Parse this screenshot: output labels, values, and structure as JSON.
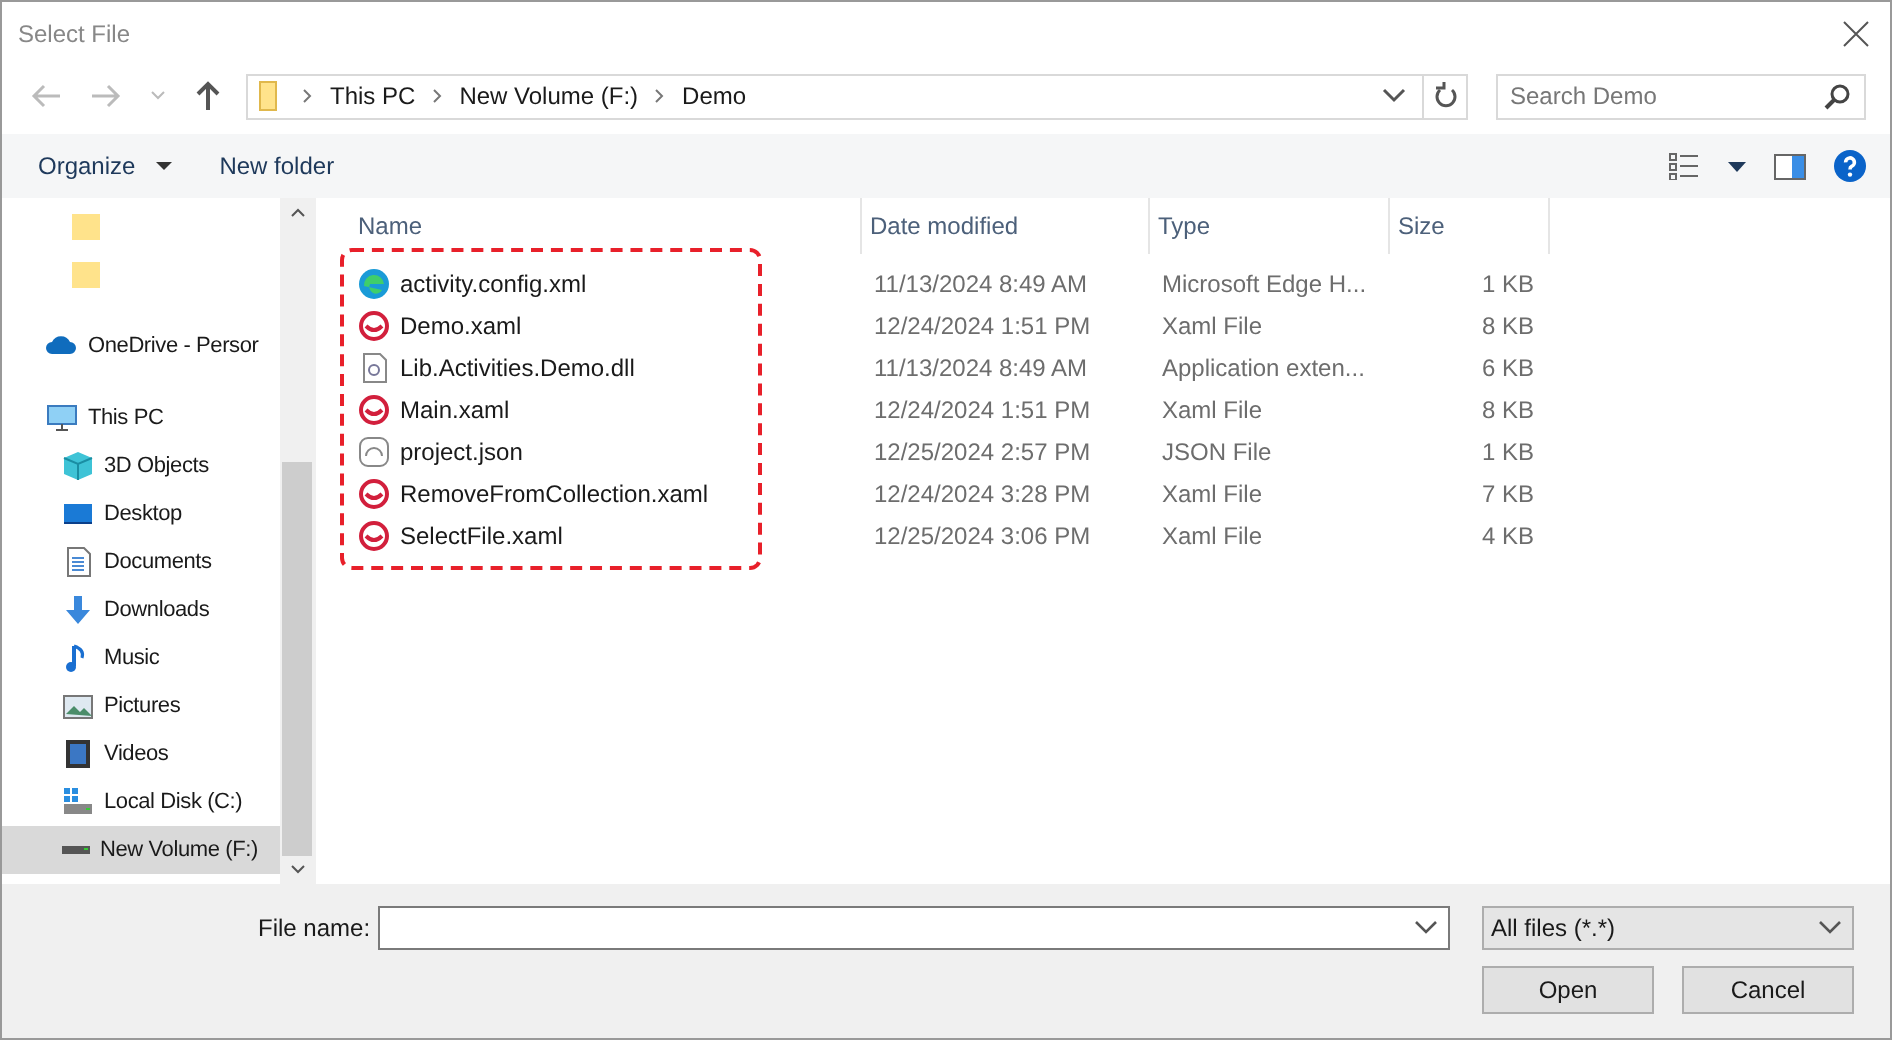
{
  "window": {
    "title": "Select File"
  },
  "address_bar": {
    "path": [
      "This PC",
      "New Volume (F:)",
      "Demo"
    ]
  },
  "search": {
    "placeholder": "Search Demo"
  },
  "toolbar": {
    "organize": "Organize",
    "new_folder": "New folder"
  },
  "sidebar": {
    "items": [
      {
        "kind": "folder",
        "selected": false
      },
      {
        "kind": "folder",
        "selected": false
      },
      {
        "kind": "cloud",
        "label": "OneDrive - Persor",
        "selected": false
      },
      {
        "kind": "pc",
        "label": "This PC",
        "selected": false,
        "children": [
          {
            "kind": "cube",
            "label": "3D Objects",
            "selected": false
          },
          {
            "kind": "desktop",
            "label": "Desktop",
            "selected": false
          },
          {
            "kind": "document",
            "label": "Documents",
            "selected": false
          },
          {
            "kind": "download",
            "label": "Downloads",
            "selected": false
          },
          {
            "kind": "music",
            "label": "Music",
            "selected": false
          },
          {
            "kind": "picture",
            "label": "Pictures",
            "selected": false
          },
          {
            "kind": "video",
            "label": "Videos",
            "selected": false
          },
          {
            "kind": "windisk",
            "label": "Local Disk (C:)",
            "selected": false
          },
          {
            "kind": "disk",
            "label": "New Volume (F:)",
            "selected": true
          }
        ]
      }
    ]
  },
  "file_list": {
    "columns": [
      "Name",
      "Date modified",
      "Type",
      "Size"
    ],
    "names_outlined": true,
    "rows": [
      {
        "kind": "edge",
        "name": "activity.config.xml",
        "date": "11/13/2024 8:49 AM",
        "type": "Microsoft Edge H...",
        "size": "1 KB"
      },
      {
        "kind": "xaml",
        "name": "Demo.xaml",
        "date": "12/24/2024 1:51 PM",
        "type": "Xaml File",
        "size": "8 KB"
      },
      {
        "kind": "dll",
        "name": "Lib.Activities.Demo.dll",
        "date": "11/13/2024 8:49 AM",
        "type": "Application exten...",
        "size": "6 KB"
      },
      {
        "kind": "xaml",
        "name": "Main.xaml",
        "date": "12/24/2024 1:51 PM",
        "type": "Xaml File",
        "size": "8 KB"
      },
      {
        "kind": "json",
        "name": "project.json",
        "date": "12/25/2024 2:57 PM",
        "type": "JSON File",
        "size": "1 KB"
      },
      {
        "kind": "xaml",
        "name": "RemoveFromCollection.xaml",
        "date": "12/24/2024 3:28 PM",
        "type": "Xaml File",
        "size": "7 KB"
      },
      {
        "kind": "xaml",
        "name": "SelectFile.xaml",
        "date": "12/25/2024 3:06 PM",
        "type": "Xaml File",
        "size": "4 KB"
      }
    ]
  },
  "footer": {
    "file_name_label": "File name:",
    "filter": "All files (*.*)",
    "buttons": [
      "Open",
      "Cancel"
    ]
  }
}
